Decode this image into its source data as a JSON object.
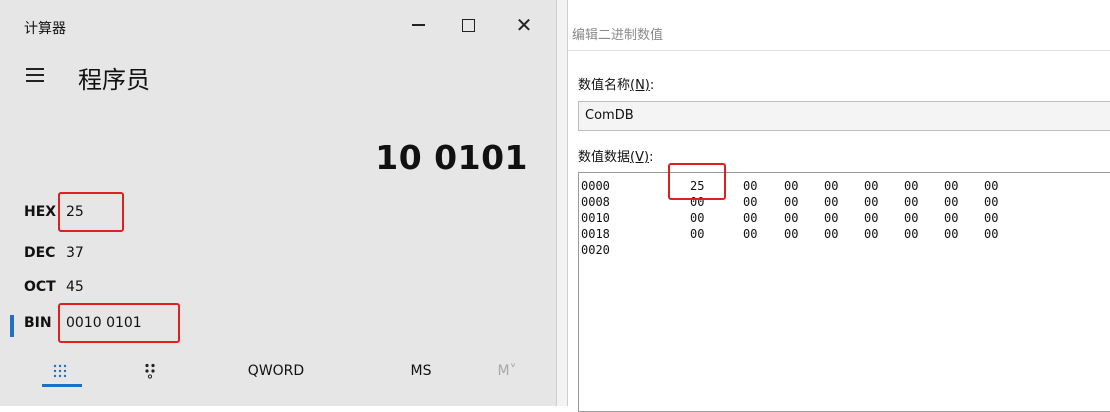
{
  "calculator": {
    "title": "计算器",
    "mode": "程序员",
    "display": "10 0101",
    "rows": [
      {
        "key": "HEX",
        "value": "25"
      },
      {
        "key": "DEC",
        "value": "37"
      },
      {
        "key": "OCT",
        "value": "45"
      },
      {
        "key": "BIN",
        "value": "0010 0101"
      }
    ],
    "active_row": "BIN",
    "bottom": {
      "keypad_icon": "keypad-icon",
      "bit_toggle_icon": "bit-toggle-icon",
      "word_size": "QWORD",
      "ms": "MS",
      "mdown": "M˅"
    },
    "window_controls": {
      "minimize": "minimize-icon",
      "maximize": "maximize-icon",
      "close": "close-icon"
    },
    "accent": "#1f6fc5",
    "highlight": "#e02020"
  },
  "editor": {
    "title": "编辑二进制数值",
    "name_label": "数值名称",
    "name_mnemonic": "(N)",
    "name_value": "ComDB",
    "data_label": "数值数据",
    "data_mnemonic": "(V)",
    "colon": ":",
    "hex_rows": [
      {
        "addr": "0000",
        "bytes": [
          "25",
          "00",
          "00",
          "00",
          "00",
          "00",
          "00",
          "00"
        ]
      },
      {
        "addr": "0008",
        "bytes": [
          "00",
          "00",
          "00",
          "00",
          "00",
          "00",
          "00",
          "00"
        ]
      },
      {
        "addr": "0010",
        "bytes": [
          "00",
          "00",
          "00",
          "00",
          "00",
          "00",
          "00",
          "00"
        ]
      },
      {
        "addr": "0018",
        "bytes": [
          "00",
          "00",
          "00",
          "00",
          "00",
          "00",
          "00",
          "00"
        ]
      },
      {
        "addr": "0020",
        "bytes": []
      }
    ]
  }
}
